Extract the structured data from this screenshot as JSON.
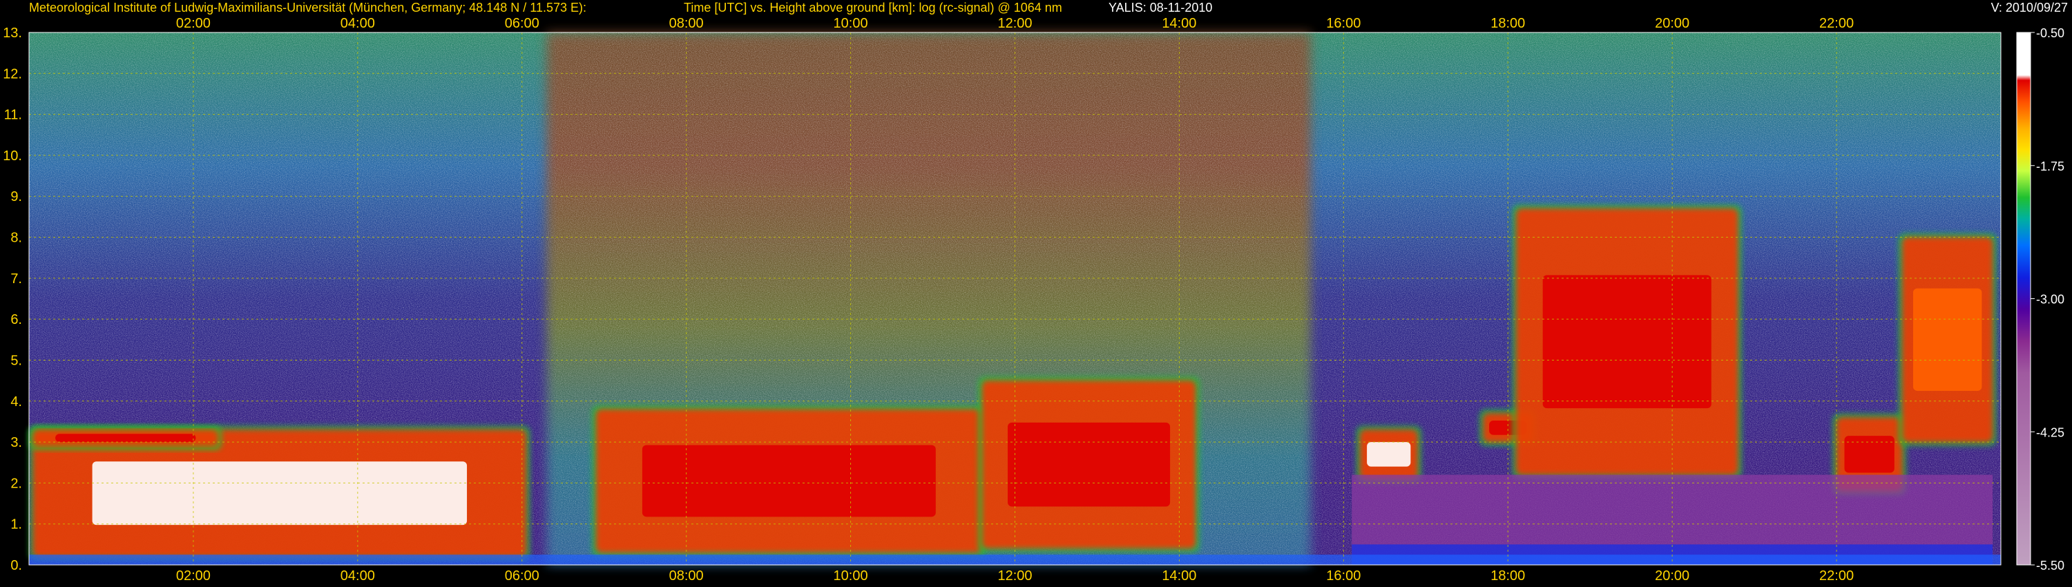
{
  "header": {
    "institute": "Meteorological Institute of Ludwig-Maximilians-Universität (München, Germany; 48.148 N / 11.573 E):",
    "plot_desc": "Time [UTC] vs. Height above ground [km]: log (rc-signal) @ 1064 nm",
    "station_date": "YALIS: 08-11-2010",
    "version": "V: 2010/09/27"
  },
  "colors": {
    "axis_label": "#ffd400",
    "grid": "#c8c800",
    "background": "#000000"
  },
  "chart_data": {
    "type": "heatmap",
    "title": "Time [UTC] vs. Height above ground [km]: log (rc-signal) @ 1064 nm",
    "x_ticks": [
      "02:00",
      "04:00",
      "06:00",
      "08:00",
      "10:00",
      "12:00",
      "14:00",
      "16:00",
      "18:00",
      "20:00",
      "22:00"
    ],
    "x_tick_hours": [
      2,
      4,
      6,
      8,
      10,
      12,
      14,
      16,
      18,
      20,
      22
    ],
    "xlim": [
      0,
      24
    ],
    "y_ticks": [
      "0.",
      "1.",
      "2.",
      "3.",
      "4.",
      "5.",
      "6.",
      "7.",
      "8.",
      "9.",
      "10.",
      "11.",
      "12.",
      "13."
    ],
    "y_tick_values": [
      0,
      1,
      2,
      3,
      4,
      5,
      6,
      7,
      8,
      9,
      10,
      11,
      12,
      13
    ],
    "ylim": [
      0,
      13
    ],
    "grid": true,
    "colorbar": {
      "ticks": [
        "-0.50",
        "-1.75",
        "-3.00",
        "-4.25",
        "-5.50"
      ],
      "tick_values": [
        -0.5,
        -1.75,
        -3.0,
        -4.25,
        -5.5
      ],
      "range": [
        -5.5,
        -0.5
      ],
      "colormap": [
        "#ffffff",
        "#e00000",
        "#ff6000",
        "#ffd000",
        "#c0ff40",
        "#20c020",
        "#00c0c0",
        "#0040ff",
        "#4000a0",
        "#a040a0",
        "#c090c0"
      ]
    },
    "regions": [
      {
        "name": "boundary-layer-aerosol-night",
        "x": [
          0.05,
          6.05
        ],
        "y": [
          0.2,
          3.3
        ],
        "level": -0.6
      },
      {
        "name": "residual-layer-night",
        "x": [
          0.05,
          2.3
        ],
        "y": [
          2.9,
          3.3
        ],
        "level": -1.2
      },
      {
        "name": "aerosol-layer-morning",
        "x": [
          6.9,
          11.6
        ],
        "y": [
          0.3,
          3.8
        ],
        "level": -0.9
      },
      {
        "name": "aerosol-layer-midday",
        "x": [
          11.6,
          14.2
        ],
        "y": [
          0.4,
          4.5
        ],
        "level": -0.9
      },
      {
        "name": "cloud-low-1600",
        "x": [
          16.2,
          16.9
        ],
        "y": [
          2.1,
          3.3
        ],
        "level": -0.7
      },
      {
        "name": "cloud-1800",
        "x": [
          17.7,
          18.3
        ],
        "y": [
          3.0,
          3.7
        ],
        "level": -1.0
      },
      {
        "name": "cloud-band-1800-2100",
        "x": [
          18.1,
          20.8
        ],
        "y": [
          2.2,
          8.7
        ],
        "level": -0.8
      },
      {
        "name": "cloud-2200",
        "x": [
          22.0,
          22.8
        ],
        "y": [
          1.8,
          3.6
        ],
        "level": -1.1
      },
      {
        "name": "cirrus-2300",
        "x": [
          22.8,
          23.9
        ],
        "y": [
          3.0,
          8.0
        ],
        "level": -1.5
      },
      {
        "name": "evening-surface-layer",
        "x": [
          16.1,
          23.9
        ],
        "y": [
          0.0,
          2.2
        ],
        "level": -4.6
      }
    ]
  }
}
